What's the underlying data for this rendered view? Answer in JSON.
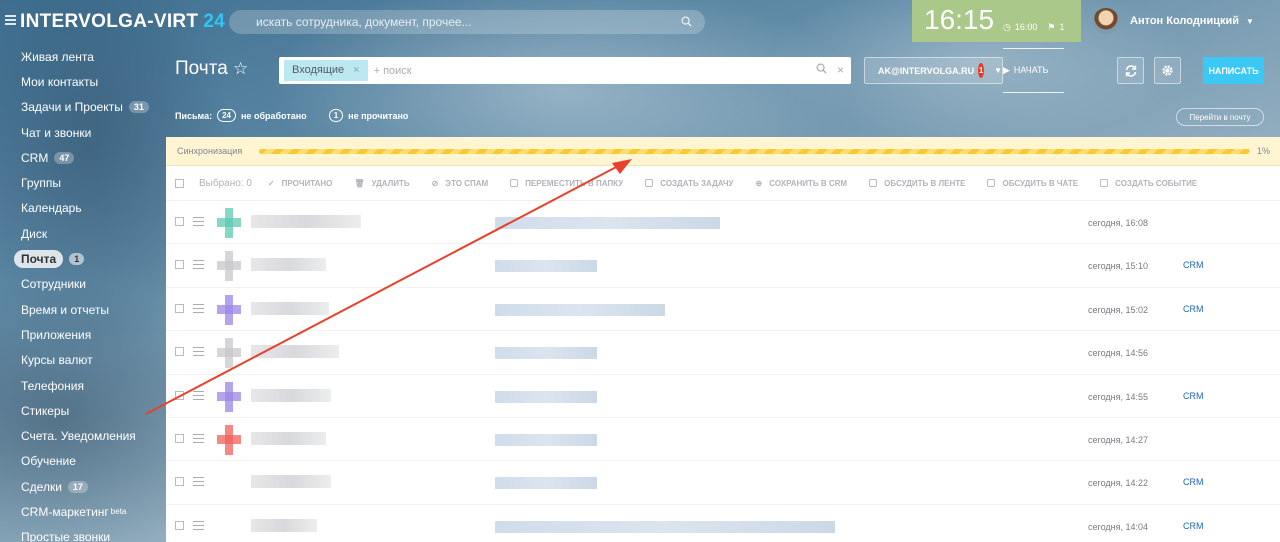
{
  "header": {
    "logo_name": "INTERVOLGA-VIRT",
    "logo_num": "24",
    "search_placeholder": "искать сотрудника, документ, прочее...",
    "time": "16:15",
    "start_time": "16:00",
    "flag_count": "1",
    "start_label": "НАЧАТЬ",
    "user_name": "Антон Колодницкий"
  },
  "sidebar": {
    "items": [
      {
        "label": "Живая лента"
      },
      {
        "label": "Мои контакты"
      },
      {
        "label": "Задачи и Проекты",
        "badge": "31"
      },
      {
        "label": "Чат и звонки"
      },
      {
        "label": "CRM",
        "badge": "47"
      },
      {
        "label": "Группы"
      },
      {
        "label": "Календарь"
      },
      {
        "label": "Диск"
      },
      {
        "label": "Почта",
        "badge": "1",
        "active": true
      },
      {
        "label": "Сотрудники"
      },
      {
        "label": "Время и отчеты"
      },
      {
        "label": "Приложения"
      },
      {
        "label": "Курсы валют"
      },
      {
        "label": "Телефония"
      },
      {
        "label": "Стикеры"
      },
      {
        "label": "Счета. Уведомления"
      },
      {
        "label": "Обучение"
      },
      {
        "label": "Сделки",
        "badge": "17"
      },
      {
        "label": "CRM-маркетинг",
        "sup": "beta"
      },
      {
        "label": "Простые звонки"
      }
    ]
  },
  "page": {
    "title": "Почта",
    "filter_chip": "Входящие",
    "filter_add": "+ поиск",
    "mailbox": "AK@INTERVOLGA.RU",
    "mailbox_counter": "1",
    "write_label": "НАПИСАТЬ",
    "counters_prefix": "Письма:",
    "unprocessed_count": "24",
    "unprocessed_label": "не обработано",
    "unread_count": "1",
    "unread_label": "не прочитано",
    "goto_label": "Перейти в почту"
  },
  "sync": {
    "label": "Синхронизация",
    "percent_text": "1%",
    "progress": 0.01
  },
  "actions": {
    "selected": "Выбрано: 0",
    "items": [
      "ПРОЧИТАНО",
      "УДАЛИТЬ",
      "ЭТО СПАМ",
      "ПЕРЕМЕСТИТЬ В ПАПКУ",
      "СОЗДАТЬ ЗАДАЧУ",
      "СОХРАНИТЬ В CRM",
      "ОБСУДИТЬ В ЛЕНТЕ",
      "ОБСУДИТЬ В ЧАТЕ",
      "СОЗДАТЬ СОБЫТИЕ"
    ]
  },
  "messages": [
    {
      "date": "сегодня, 16:08",
      "crm": "",
      "color": "#f0605a"
    },
    {
      "date": "сегодня, 15:10",
      "crm": "CRM",
      "color": "#9c86e6"
    },
    {
      "date": "сегодня, 15:02",
      "crm": "CRM",
      "color": "#5ec9b0"
    },
    {
      "date": "сегодня, 14:56",
      "crm": "",
      "color": "#c8c8cc"
    },
    {
      "date": "сегодня, 14:55",
      "crm": "CRM",
      "color": "#9c86e6"
    },
    {
      "date": "сегодня, 14:27",
      "crm": "",
      "color": "#c8c8cc"
    },
    {
      "date": "сегодня, 14:22",
      "crm": "CRM",
      "color": "#9c86e6"
    },
    {
      "date": "сегодня, 14:04",
      "crm": "CRM",
      "color": "#f0605a"
    }
  ],
  "colors": {
    "accent": "#3bc8f5",
    "badge_red": "#f0371b",
    "clock_bg": "#a9c88a",
    "sync_bar": "#f4cb32",
    "annotation_arrow": "#e8412c"
  }
}
